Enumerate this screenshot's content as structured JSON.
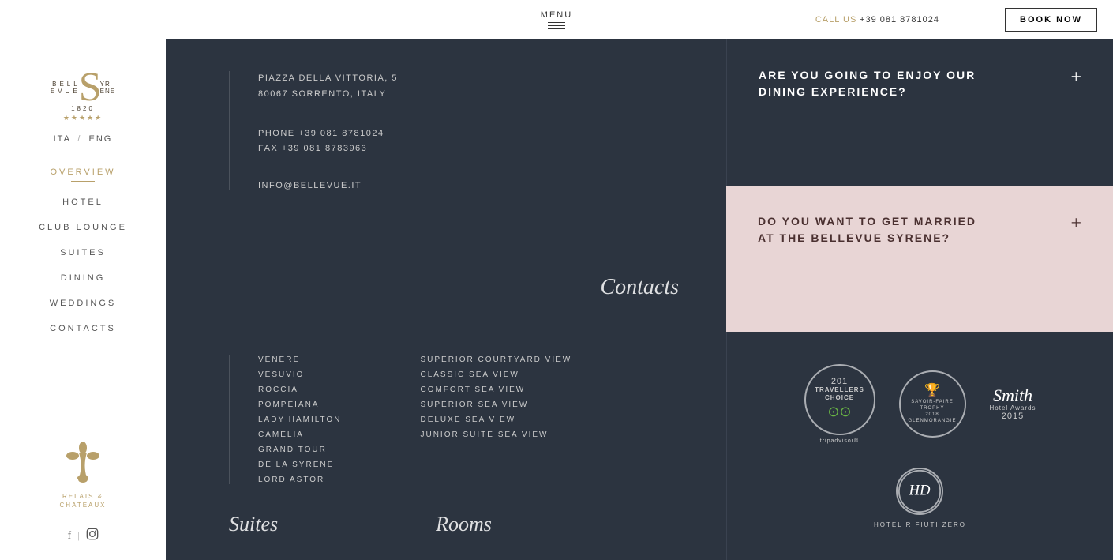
{
  "header": {
    "menu_label": "MENU",
    "call_label": "CALL US",
    "call_number": "+39 081 8781024",
    "book_label": "BOOK NOW"
  },
  "sidebar": {
    "logo": {
      "bellevue": "BELLEVUE",
      "syrene": "YRENE",
      "year": "1820",
      "stars": "★★★★★"
    },
    "lang": {
      "ita": "ITA",
      "sep": "/",
      "eng": "ENG"
    },
    "nav": [
      {
        "label": "OVERVIEW",
        "active": true
      },
      {
        "label": "HOTEL",
        "active": false
      },
      {
        "label": "CLUB LOUNGE",
        "active": false
      },
      {
        "label": "SUITES",
        "active": false
      },
      {
        "label": "DINING",
        "active": false
      },
      {
        "label": "WEDDINGS",
        "active": false
      },
      {
        "label": "CONTACTS",
        "active": false
      }
    ],
    "rc_label1": "RELAIS &",
    "rc_label2": "CHATEAUX"
  },
  "contacts": {
    "address_line1": "PIAZZA DELLA VITTORIA, 5",
    "address_line2": "80067 SORRENTO, ITALY",
    "phone": "PHONE +39 081 8781024",
    "fax": "FAX +39 081 8783963",
    "email": "INFO@BELLEVUE.IT",
    "title": "Contacts"
  },
  "dining_panel": {
    "text": "ARE YOU GOING TO ENJOY OUR DINING EXPERIENCE?",
    "plus": "+"
  },
  "wedding_panel": {
    "text": "DO YOU WANT TO GET MARRIED AT THE BELLEVUE SYRENE?",
    "plus": "+"
  },
  "suites": {
    "items": [
      "VENERE",
      "VESUVIO",
      "ROCCIA",
      "POMPEIANA",
      "LADY HAMILTON",
      "CAMELIA",
      "GRAND TOUR",
      "DE LA SYRENE",
      "LORD ASTOR"
    ],
    "title": "Suites"
  },
  "rooms": {
    "items": [
      "SUPERIOR COURTYARD VIEW",
      "CLASSIC SEA VIEW",
      "COMFORT SEA VIEW",
      "SUPERIOR SEA VIEW",
      "DELUXE SEA VIEW",
      "JUNIOR SUITE SEA VIEW"
    ],
    "title": "Rooms"
  },
  "awards": {
    "tripadvisor": {
      "number": "201",
      "tc_line1": "TRAVELLERS",
      "tc_line2": "CHOICE",
      "name": "tripadvisor®"
    },
    "savoir_faire": {
      "line1": "SAVOIR-FAIRE TROPHY",
      "year": "2018",
      "brand": "GLENMORANGIE"
    },
    "smith": {
      "letter": "Smith",
      "line1": "Hotel Awards",
      "year": "2015"
    },
    "hotel_rifiuti": {
      "initials": "HD",
      "text": "HOTEL RIFIUTI ZERO"
    }
  }
}
